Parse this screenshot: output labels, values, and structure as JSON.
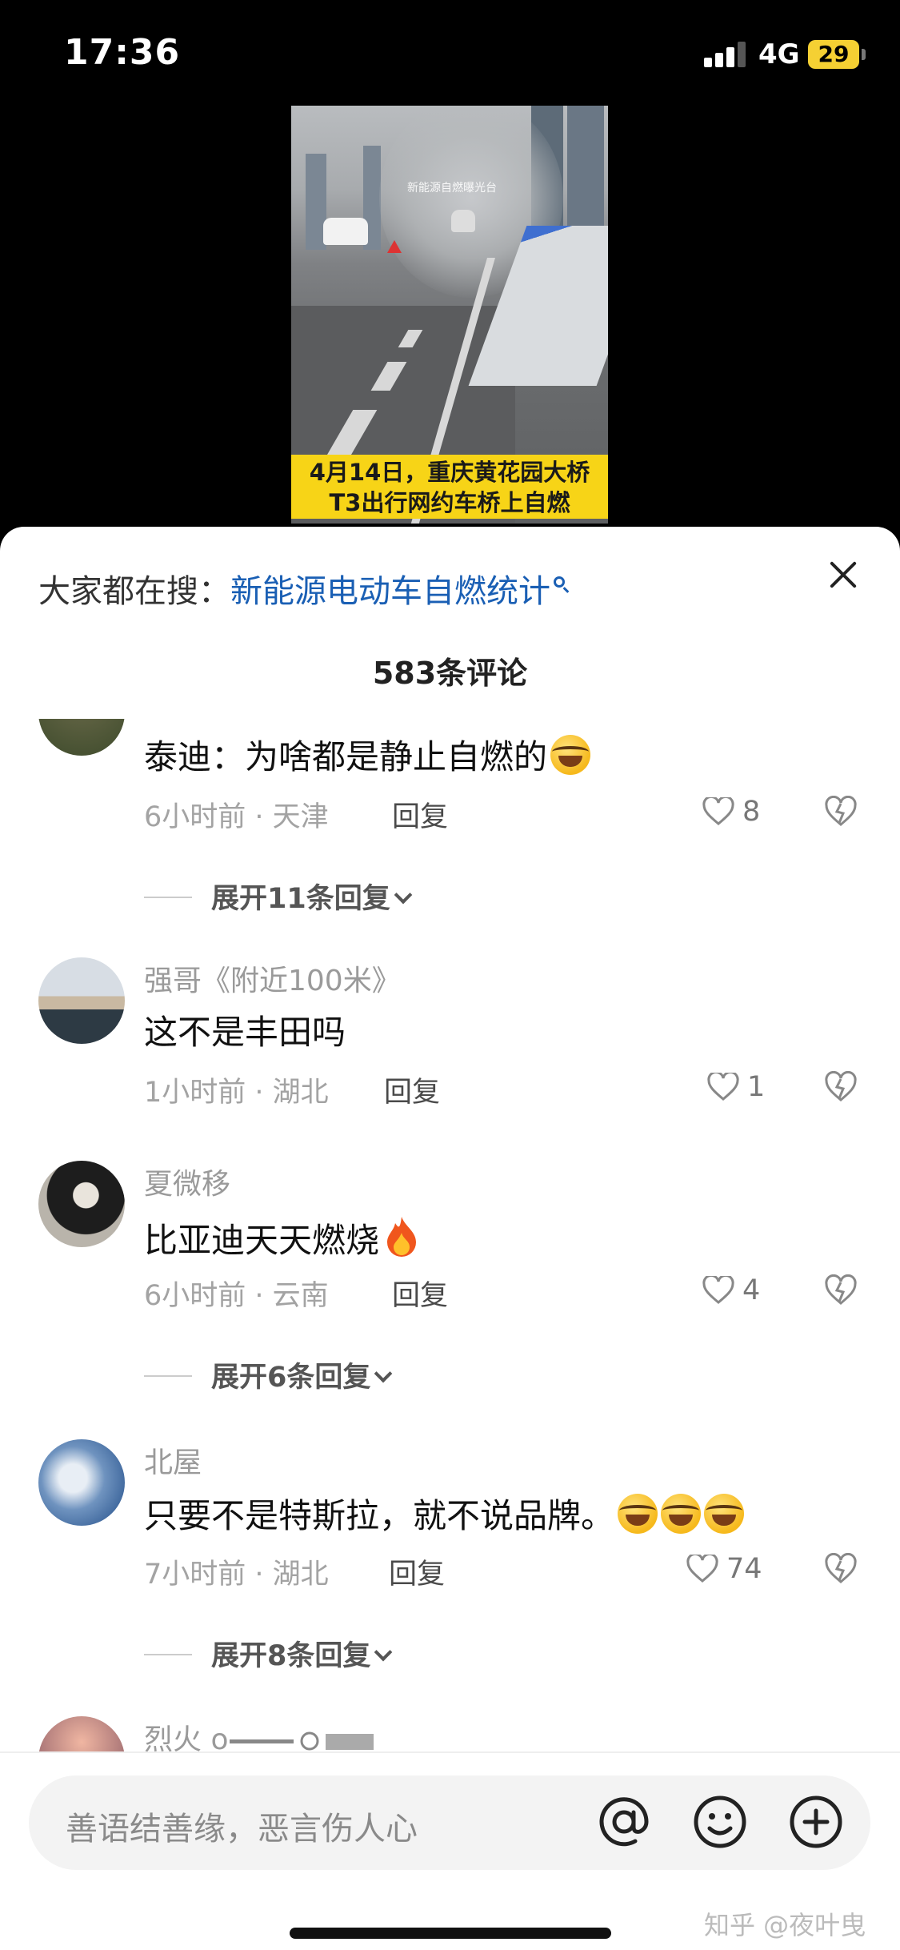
{
  "status_bar": {
    "time": "17:36",
    "network": "4G",
    "battery": "29"
  },
  "video": {
    "watermark": "新能源自燃曝光台",
    "caption_line1": "4月14日，重庆黄花园大桥",
    "caption_line2": "T3出行网约车桥上自燃"
  },
  "hot_search": {
    "prefix": "大家都在搜：",
    "keyword": "新能源电动车自燃统计"
  },
  "comment_count": "583条评论",
  "comments": [
    {
      "text": "泰迪：为啥都是静止自燃的",
      "time_location": "6小时前 · 天津",
      "reply": "回复",
      "likes": "8",
      "expand": "展开11条回复"
    },
    {
      "nickname": "强哥《附近100米》",
      "text": "这不是丰田吗",
      "time_location": "1小时前 · 湖北",
      "reply": "回复",
      "likes": "1"
    },
    {
      "nickname": "夏微移",
      "text": "比亚迪天天燃烧",
      "time_location": "6小时前 · 云南",
      "reply": "回复",
      "likes": "4",
      "expand": "展开6条回复"
    },
    {
      "nickname": "北屋",
      "text": "只要不是特斯拉，就不说品牌。",
      "time_location": "7小时前 · 湖北",
      "reply": "回复",
      "likes": "74",
      "expand": "展开8条回复"
    },
    {
      "nickname": "烈火 o"
    }
  ],
  "input": {
    "placeholder": "善语结善缘，恶言伤人心"
  },
  "watermark": "知乎 @夜叶曳",
  "colors": {
    "accent_link": "#1a5fb4",
    "caption_bg": "#f7d417",
    "battery_bg": "#f5d033"
  }
}
